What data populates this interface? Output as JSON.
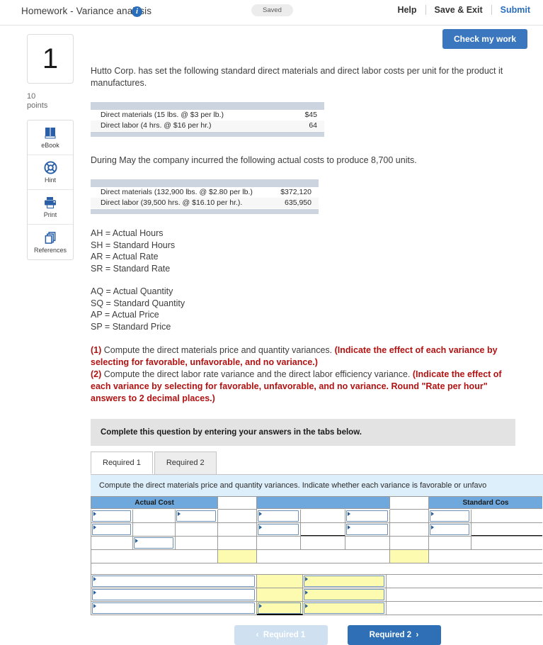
{
  "header": {
    "title": "Homework - Variance analysis",
    "info_icon": "info-icon",
    "saved_badge": "Saved",
    "links": {
      "help": "Help",
      "save_exit": "Save & Exit",
      "submit": "Submit"
    },
    "check_my_work": "Check my work"
  },
  "rail": {
    "question_number": "1",
    "points_value": "10",
    "points_label": "points",
    "tools": [
      {
        "label": "eBook",
        "icon": "book-icon"
      },
      {
        "label": "Hint",
        "icon": "lifebuoy-icon"
      },
      {
        "label": "Print",
        "icon": "printer-icon"
      },
      {
        "label": "References",
        "icon": "copy-pages-icon"
      }
    ]
  },
  "body": {
    "intro": "Hutto Corp. has set the following standard direct materials and direct labor costs per unit for the product it manufactures.",
    "standard_table": [
      {
        "label": "Direct materials (15 lbs. @ $3 per lb.)",
        "amount": "$45"
      },
      {
        "label": "Direct labor (4 hrs. @ $16 per hr.)",
        "amount": "64"
      }
    ],
    "actual_intro": "During May the company incurred the following actual costs to produce 8,700 units.",
    "actual_table": [
      {
        "label": "Direct materials (132,900 lbs. @ $2.80 per lb.)",
        "amount": "$372,120"
      },
      {
        "label": "Direct labor (39,500 hrs. @ $16.10 per hr.).",
        "amount": "635,950"
      }
    ],
    "abbreviations_group_1": [
      "AH = Actual Hours",
      "SH = Standard Hours",
      "AR = Actual Rate",
      "SR = Standard Rate"
    ],
    "abbreviations_group_2": [
      "AQ = Actual Quantity",
      "SQ = Standard Quantity",
      "AP = Actual Price",
      "SP = Standard Price"
    ],
    "requirement_1_num": "(1)",
    "requirement_1_text": " Compute the direct materials price and quantity variances. ",
    "requirement_1_bold": "(Indicate the effect of each variance by selecting for favorable, unfavorable, and no variance.)",
    "requirement_2_num": "(2)",
    "requirement_2_text": " Compute the direct labor rate variance and the direct labor efficiency variance. ",
    "requirement_2_bold": "(Indicate the effect of each variance by selecting for favorable, unfavorable, and no variance. Round \"Rate per hour\" answers to 2 decimal places.)"
  },
  "answer_panel": {
    "instruction": "Complete this question by entering your answers in the tabs below.",
    "tabs": [
      {
        "label": "Required 1",
        "active": true
      },
      {
        "label": "Required 2",
        "active": false
      }
    ],
    "tab_description": "Compute the direct materials price and quantity variances. Indicate whether each variance is favorable or unfavo",
    "grid_headers": {
      "actual_cost": "Actual Cost",
      "middle": "",
      "standard_cost": "Standard Cos"
    }
  },
  "footer": {
    "prev_label": "Required 1",
    "prev_icon": "chevron-left-icon",
    "next_label": "Required 2",
    "next_icon": "chevron-right-icon"
  },
  "colors": {
    "accent_blue": "#2f6fb5",
    "header_blue": "#6fa8dc",
    "warn_red": "#b11212",
    "yellow_cell": "#fdfbb0",
    "panel_gray": "#e3e3e3",
    "desc_blue": "#ddeffb"
  }
}
